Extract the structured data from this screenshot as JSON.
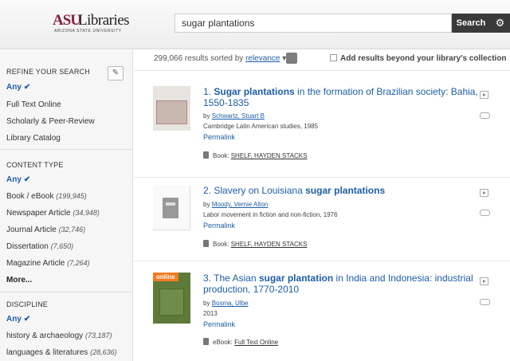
{
  "header": {
    "logo_asu": "ASU",
    "logo_libraries": "Libraries",
    "logo_sub": "ARIZONA STATE UNIVERSITY",
    "search_value": "sugar plantations",
    "search_button": "Search",
    "settings_icon": "gear-icon"
  },
  "results_bar": {
    "count_text": "299,066 results sorted by",
    "sort_value": "relevance",
    "add_results_label": "Add results beyond your library's collection"
  },
  "sidebar": {
    "refine_heading": "REFINE YOUR SEARCH",
    "refine_items": [
      {
        "label": "Any",
        "selected": true
      },
      {
        "label": "Full Text Online"
      },
      {
        "label": "Scholarly & Peer-Review"
      },
      {
        "label": "Library Catalog"
      }
    ],
    "content_type_heading": "CONTENT TYPE",
    "content_type_items": [
      {
        "label": "Any",
        "selected": true
      },
      {
        "label": "Book / eBook",
        "count": "(199,945)"
      },
      {
        "label": "Newspaper Article",
        "count": "(34,948)"
      },
      {
        "label": "Journal Article",
        "count": "(32,746)"
      },
      {
        "label": "Dissertation",
        "count": "(7,650)"
      },
      {
        "label": "Magazine Article",
        "count": "(7,264)"
      }
    ],
    "more_label": "More...",
    "discipline_heading": "DISCIPLINE",
    "discipline_items": [
      {
        "label": "Any",
        "selected": true
      },
      {
        "label": "history & archaeology",
        "count": "(73,187)"
      },
      {
        "label": "languages & literatures",
        "count": "(28,636)"
      }
    ]
  },
  "results": [
    {
      "number": "1.",
      "title_bold_1": "Sugar plantations",
      "title_rest": " in the formation of Brazilian society: Bahia, 1550-1835",
      "by": "by",
      "author": "Schwartz, Stuart B",
      "meta": "Cambridge Latin American studies, 1985",
      "permalink": "Permalink",
      "holding_type": "Book:",
      "holding_loc": "SHELF, HAYDEN STACKS"
    },
    {
      "number": "2.",
      "title_pre": "Slavery on Louisiana ",
      "title_bold": "sugar plantations",
      "by": "by",
      "author": "Moody, Vernie Alton",
      "meta": "Labor movement in fiction and non-fiction, 1976",
      "permalink": "Permalink",
      "holding_type": "Book:",
      "holding_loc": "SHELF, HAYDEN STACKS"
    },
    {
      "number": "3.",
      "title_pre": "The Asian ",
      "title_bold": "sugar plantation",
      "title_rest": " in India and Indonesia: industrial production, 1770-2010",
      "by": "by",
      "author": "Bosma, Ulbe",
      "meta": "2013",
      "permalink": "Permalink",
      "online_badge": "online",
      "holding_type": "eBook:",
      "holding_loc": "Full Text Online"
    }
  ]
}
